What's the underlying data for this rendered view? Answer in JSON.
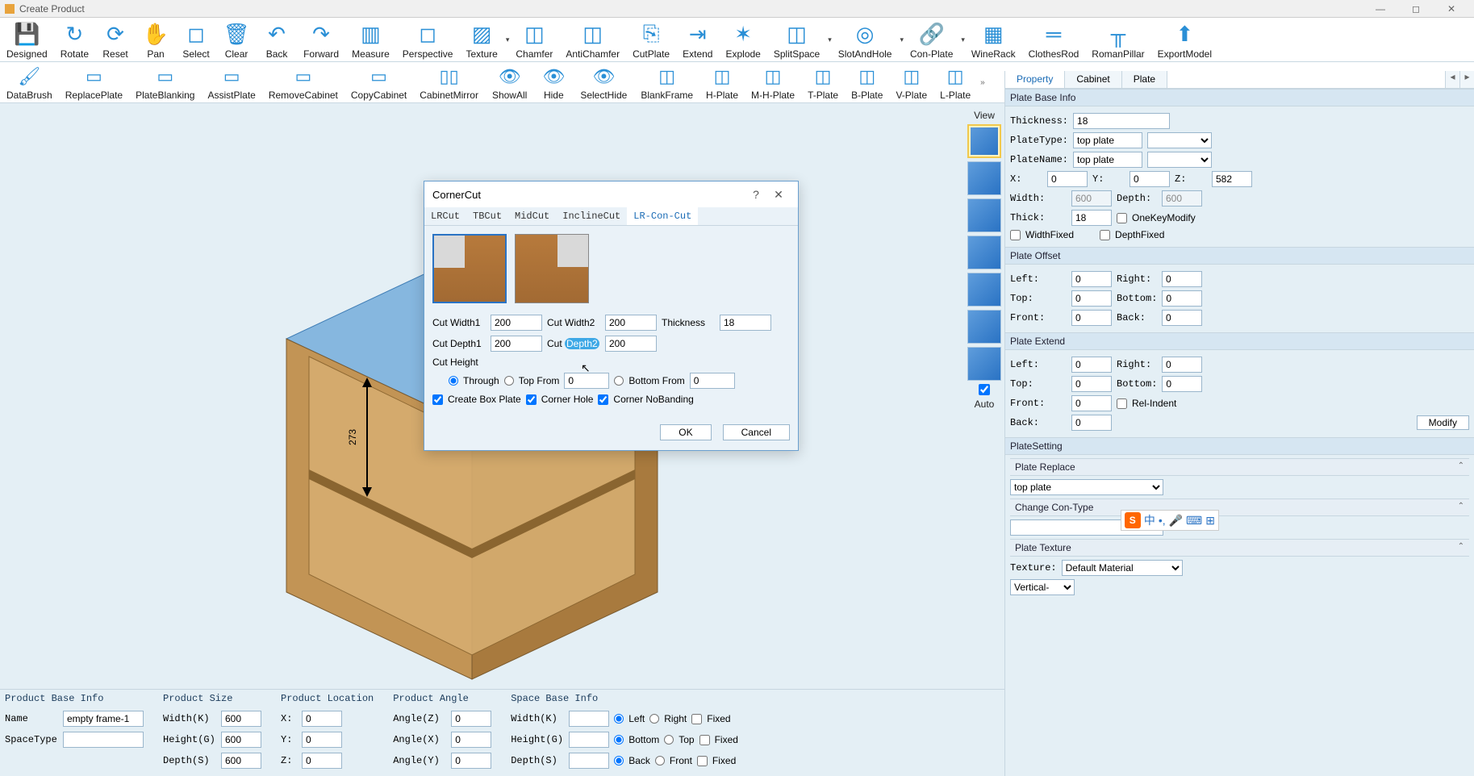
{
  "window": {
    "title": "Create Product"
  },
  "ribbon1": [
    {
      "label": "Designed",
      "icon": "💾"
    },
    {
      "label": "Rotate",
      "icon": "↻"
    },
    {
      "label": "Reset",
      "icon": "⟳"
    },
    {
      "label": "Pan",
      "icon": "✋"
    },
    {
      "label": "Select",
      "icon": "◻"
    },
    {
      "label": "Clear",
      "icon": "🗑"
    },
    {
      "label": "Back",
      "icon": "↶"
    },
    {
      "label": "Forward",
      "icon": "↷"
    },
    {
      "label": "Measure",
      "icon": "▥"
    },
    {
      "label": "Perspective",
      "icon": "◻"
    },
    {
      "label": "Texture",
      "icon": "▨"
    },
    {
      "label": "Chamfer",
      "icon": "◫"
    },
    {
      "label": "AntiChamfer",
      "icon": "◫"
    },
    {
      "label": "CutPlate",
      "icon": "⎘"
    },
    {
      "label": "Extend",
      "icon": "⇥"
    },
    {
      "label": "Explode",
      "icon": "✶"
    },
    {
      "label": "SplitSpace",
      "icon": "◫"
    },
    {
      "label": "SlotAndHole",
      "icon": "◎"
    },
    {
      "label": "Con-Plate",
      "icon": "🔗"
    },
    {
      "label": "WineRack",
      "icon": "▦"
    },
    {
      "label": "ClothesRod",
      "icon": "═"
    },
    {
      "label": "RomanPillar",
      "icon": "╥"
    },
    {
      "label": "ExportModel",
      "icon": "⬆"
    }
  ],
  "ribbon2": [
    {
      "label": "DataBrush",
      "icon": "🖌"
    },
    {
      "label": "ReplacePlate",
      "icon": "▭"
    },
    {
      "label": "PlateBlanking",
      "icon": "▭"
    },
    {
      "label": "AssistPlate",
      "icon": "▭"
    },
    {
      "label": "RemoveCabinet",
      "icon": "▭"
    },
    {
      "label": "CopyCabinet",
      "icon": "▭"
    },
    {
      "label": "CabinetMirror",
      "icon": "▯▯"
    },
    {
      "label": "ShowAll",
      "icon": "👁"
    },
    {
      "label": "Hide",
      "icon": "👁"
    },
    {
      "label": "SelectHide",
      "icon": "👁"
    },
    {
      "label": "BlankFrame",
      "icon": "◫"
    },
    {
      "label": "H-Plate",
      "icon": "◫"
    },
    {
      "label": "M-H-Plate",
      "icon": "◫"
    },
    {
      "label": "T-Plate",
      "icon": "◫"
    },
    {
      "label": "B-Plate",
      "icon": "◫"
    },
    {
      "label": "V-Plate",
      "icon": "◫"
    },
    {
      "label": "L-Plate",
      "icon": "◫"
    }
  ],
  "viewStrip": {
    "label": "View",
    "auto": "Auto"
  },
  "propTabs": {
    "property": "Property",
    "cabinet": "Cabinet",
    "plate": "Plate"
  },
  "plateBase": {
    "header": "Plate Base Info",
    "thicknessL": "Thickness:",
    "thickness": "18",
    "plateTypeL": "PlateType:",
    "plateType": "top plate",
    "plateNameL": "PlateName:",
    "plateName": "top plate",
    "x": "0",
    "y": "0",
    "z": "582",
    "widthL": "Width:",
    "width": "600",
    "depthL": "Depth:",
    "depth": "600",
    "thickL": "Thick:",
    "thick": "18",
    "oneKey": "OneKeyModify",
    "widthFixed": "WidthFixed",
    "depthFixed": "DepthFixed"
  },
  "plateOffset": {
    "header": "Plate Offset",
    "leftL": "Left:",
    "left": "0",
    "rightL": "Right:",
    "right": "0",
    "topL": "Top:",
    "top": "0",
    "bottomL": "Bottom:",
    "bottom": "0",
    "frontL": "Front:",
    "front": "0",
    "backL": "Back:",
    "back": "0"
  },
  "plateExtend": {
    "header": "Plate Extend",
    "leftL": "Left:",
    "left": "0",
    "rightL": "Right:",
    "right": "0",
    "topL": "Top:",
    "top": "0",
    "bottomL": "Bottom:",
    "bottom": "0",
    "frontL": "Front:",
    "front": "0",
    "relIndent": "Rel-Indent",
    "backL": "Back:",
    "back": "0",
    "modify": "Modify"
  },
  "plateSetting": {
    "header": "PlateSetting"
  },
  "plateReplace": {
    "header": "Plate Replace",
    "value": "top plate"
  },
  "conType": {
    "header": "Change Con-Type"
  },
  "plateTexture": {
    "header": "Plate Texture",
    "textureL": "Texture:",
    "texture": "Default Material",
    "orient": "Vertical-"
  },
  "bottom": {
    "productBase": {
      "header": "Product Base Info",
      "nameL": "Name",
      "name": "empty frame-1",
      "spaceTypeL": "SpaceType"
    },
    "productSize": {
      "header": "Product Size",
      "widthL": "Width(K)",
      "width": "600",
      "heightL": "Height(G)",
      "height": "600",
      "depthL": "Depth(S)",
      "depth": "600"
    },
    "productLoc": {
      "header": "Product Location",
      "xL": "X:",
      "x": "0",
      "yL": "Y:",
      "y": "0",
      "zL": "Z:",
      "z": "0"
    },
    "productAngle": {
      "header": "Product Angle",
      "azL": "Angle(Z)",
      "az": "0",
      "axL": "Angle(X)",
      "ax": "0",
      "ayL": "Angle(Y)",
      "ay": "0"
    },
    "spaceBase": {
      "header": "Space Base Info",
      "widthL": "Width(K)",
      "heightL": "Height(G)",
      "depthL": "Depth(S)",
      "left": "Left",
      "right": "Right",
      "bottom": "Bottom",
      "top": "Top",
      "back": "Back",
      "front": "Front",
      "fixed": "Fixed"
    }
  },
  "dialog": {
    "title": "CornerCut",
    "tabs": [
      "LRCut",
      "TBCut",
      "MidCut",
      "InclineCut",
      "LR-Con-Cut"
    ],
    "activeTab": 4,
    "cutWidth1L": "Cut Width1",
    "cutWidth1": "200",
    "cutWidth2L": "Cut Width2",
    "cutWidth2": "200",
    "thicknessL": "Thickness",
    "thickness": "18",
    "cutDepth1L": "Cut Depth1",
    "cutDepth1": "200",
    "cutDepth2L": "Cut ",
    "cutDepth2HL": "Depth2",
    "cutDepth2": "200",
    "cutHeightL": "Cut Height",
    "through": "Through",
    "topFrom": "Top From",
    "topFromV": "0",
    "bottomFrom": "Bottom From",
    "bottomFromV": "0",
    "createBox": "Create Box Plate",
    "cornerHole": "Corner Hole",
    "cornerNoBanding": "Corner NoBanding",
    "ok": "OK",
    "cancel": "Cancel"
  },
  "dimension": "273",
  "ime": {
    "zh": "中",
    "punct": "•,",
    "mic": "🎤",
    "kbd": "⌨",
    "grid": "⊞"
  }
}
